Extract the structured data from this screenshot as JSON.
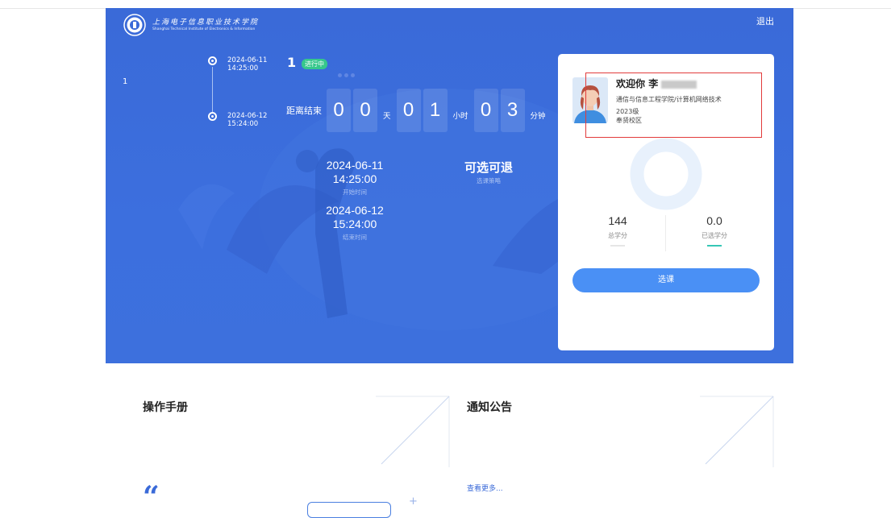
{
  "header": {
    "school_name_cn": "上海电子信息职业技术学院",
    "school_name_en": "Shanghai Technical Institute of Electronics & Information",
    "logout_label": "退出"
  },
  "side_index": "1",
  "timeline": {
    "start_date": "2024-06-11",
    "start_time": "14:25:00",
    "end_date": "2024-06-12",
    "end_time": "15:24:00"
  },
  "round": {
    "number": "1",
    "status": "进行中"
  },
  "countdown": {
    "label": "距离结束",
    "days": [
      "0",
      "0"
    ],
    "day_unit": "天",
    "hours": [
      "0",
      "1"
    ],
    "hour_unit": "小时",
    "minutes": [
      "0",
      "3"
    ],
    "minute_unit": "分钟"
  },
  "schedule": {
    "start_value": "2024-06-11 14:25:00",
    "start_label": "开始时间",
    "end_value": "2024-06-12 15:24:00",
    "end_label": "结束时间",
    "policy_value": "可选可退",
    "policy_label": "选课策略"
  },
  "profile": {
    "welcome": "欢迎你",
    "name_initial": "李",
    "department": "通信与信息工程学院/计算机网络技术",
    "grade": "2023级",
    "campus": "奉贤校区"
  },
  "credits": {
    "total_value": "144",
    "total_label": "总学分",
    "selected_value": "0.0",
    "selected_label": "已选学分"
  },
  "select_button_label": "选课",
  "panels": {
    "manual_title": "操作手册",
    "notice_title": "通知公告",
    "more_link": "查看更多..."
  },
  "colors": {
    "hero_blue": "#3a6ad8",
    "button_blue": "#4a90f5",
    "badge_green": "#36c78c",
    "highlight_red": "#e23b3b"
  }
}
